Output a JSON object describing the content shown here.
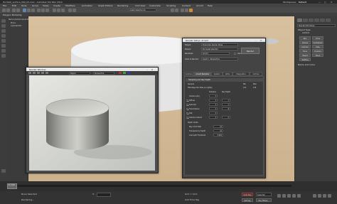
{
  "window": {
    "title": "Turntabl_surface_Mat_02.max - Autodesk 3ds Max 2019",
    "workspace_label": "Workspaces:",
    "workspace_value": "Default"
  },
  "menu": [
    "File",
    "Edit",
    "Tools",
    "Group",
    "Views",
    "Create",
    "Modifiers",
    "Animation",
    "Graph Editors",
    "Rendering",
    "Civil View",
    "Customize",
    "Scripting",
    "Content",
    "Arnold",
    "Help"
  ],
  "ribbon": {
    "left_label": "Polygon Modeling",
    "selection_set": "Create Selection Se"
  },
  "scene_explorer": {
    "header": "Name (Sorted Ascending)",
    "items": [
      "Plane",
      "Cylinder001"
    ]
  },
  "viewport": {
    "label": "[+] [Perspective] [User Defined] [Default Shading]"
  },
  "command_panel": {
    "search_label": "Standard Primitives",
    "object_type_header": "Object Type",
    "autogrid": "AutoGrid",
    "buttons": [
      "Box",
      "Cone",
      "Sphere",
      "GeoSphere",
      "Cylinder",
      "Tube",
      "Torus",
      "Pyramid",
      "Teapot",
      "Plane",
      "TextPlus"
    ],
    "name_color_header": "Name and Color"
  },
  "render_window": {
    "title": "Render Window",
    "view_combo": "Perspective",
    "area_combo": "Region",
    "frame_combo": "RGB Alpha"
  },
  "render_setup": {
    "title": "Render Setup: Arnold",
    "target_label": "Target:",
    "target_value": "Production Render Mode",
    "preset_label": "Preset:",
    "preset_value": "No preset selected",
    "renderer_label": "Renderer:",
    "renderer_value": "Arnold",
    "save_file": "Save File",
    "view_label": "View to Render:",
    "view_value": "Quad 4 - Perspective",
    "render_button": "Render",
    "tabs": [
      "Common",
      "Arnold Renderer",
      "System",
      "AOVs",
      "Diagnostics",
      "Archive"
    ],
    "sampling_header": "Sampling and Ray Depth",
    "general_label": "General",
    "min_label": "Min",
    "max_label": "Max",
    "rays_label": "Total Rays Per Pixel (no lights)",
    "rays_min": "121",
    "rays_max": "135",
    "samples_label": "Samples",
    "ray_depth_label": "Ray Depth",
    "rows": [
      {
        "label": "Camera (AA)",
        "samples": "3",
        "depth": ""
      },
      {
        "label": "Diffuse",
        "samples": "2",
        "depth": "1"
      },
      {
        "label": "Specular",
        "samples": "2",
        "depth": "1"
      },
      {
        "label": "Transmission",
        "samples": "2",
        "depth": "8"
      },
      {
        "label": "SSS",
        "samples": "2",
        "depth": ""
      },
      {
        "label": "Volume Indirect",
        "samples": "2",
        "depth": "0"
      }
    ],
    "depth_limits_label": "Depth Limits",
    "ray_limit_label": "Ray Limit Total",
    "ray_limit_value": "10",
    "transparency_label": "Transparency Depth",
    "transparency_value": "10",
    "low_light_label": "Low Light Threshold",
    "low_light_value": "0.001"
  },
  "timeline": {
    "frame_text": "0 / 100"
  },
  "status": {
    "selection": "None Selected",
    "prompt": "Rendering...",
    "coords_label": "X:",
    "grid": "Grid = 10.0",
    "add_time_tag": "Add Time Tag",
    "autokey": "Auto Key",
    "selected": "Selected",
    "set_key": "Set Key",
    "key_filters": "Key Filters..."
  },
  "colors": {
    "viewport_bg": "#d9c2a1",
    "accent": "#5a86b0"
  }
}
